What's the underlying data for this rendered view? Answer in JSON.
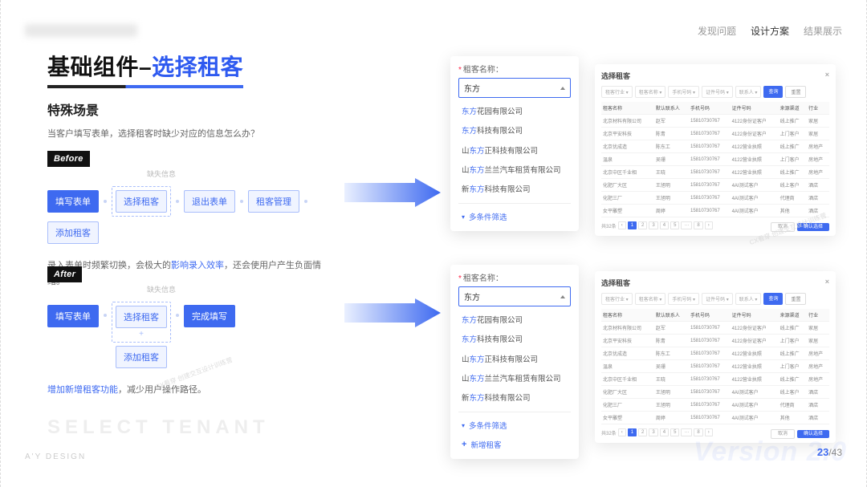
{
  "nav": {
    "item1": "发现问题",
    "item2": "设计方案",
    "item3": "结果展示"
  },
  "title": {
    "black": "基础组件–",
    "blue": "选择租客"
  },
  "section": {
    "subtitle": "特殊场景",
    "intro": "当客户填写表单，选择租客时缺少对应的信息怎么办？"
  },
  "before": {
    "badge": "Before",
    "hint": "缺失信息",
    "steps": [
      "填写表单",
      "选择租客",
      "退出表单",
      "租客管理",
      "添加租客"
    ],
    "desc_pre": "录入表单时频繁切换，会极大的",
    "desc_hl": "影响录入效率",
    "desc_suf": "，还会使用户产生负面情绪。"
  },
  "after": {
    "badge": "After",
    "hint": "缺失信息",
    "steps_row": [
      "填写表单",
      "选择租客",
      "完成填写"
    ],
    "add_label": "添加租客",
    "desc_pre": "",
    "desc_hl": "增加新增租客功能",
    "desc_suf": "，减少用户操作路径。"
  },
  "dropdown": {
    "label": "租客名称：",
    "required": "*",
    "input": "东方",
    "options": [
      {
        "prefix": "",
        "match": "东方",
        "suffix": "花园有限公司"
      },
      {
        "prefix": "",
        "match": "东方",
        "suffix": "科技有限公司"
      },
      {
        "prefix": "山",
        "match": "东方",
        "suffix": "正科技有限公司"
      },
      {
        "prefix": "山",
        "match": "东方",
        "suffix": "兰兰汽车租赁有限公司"
      },
      {
        "prefix": "新",
        "match": "东方",
        "suffix": "科技有限公司"
      }
    ],
    "filter_action": "多条件筛选",
    "add_action": "新增租客"
  },
  "table": {
    "title": "选择租客",
    "filters": [
      "租客行业",
      "租客名称",
      "手机号码",
      "证件号码",
      "联系人"
    ],
    "filter_more": "查询",
    "filter_reset": "重置",
    "headers": [
      "租客名称",
      "默认联系人",
      "手机号码",
      "证件号码",
      "来源渠道",
      "行业"
    ],
    "rows": [
      [
        "北京材料有限公司",
        "赵军",
        "15810730767",
        "4122身份证客户",
        "线上推广",
        "家居"
      ],
      [
        "北京平安科技",
        "陈青",
        "15810730767",
        "4122身份证客户",
        "上门客户",
        "家居"
      ],
      [
        "北京优成造",
        "陈东工",
        "15810730767",
        "4122营业执照",
        "线上推广",
        "房地产"
      ],
      [
        "温泉",
        "吴珊",
        "15810730767",
        "4122营业执照",
        "上门客户",
        "房地产"
      ],
      [
        "北京中区千业相",
        "王晓",
        "15810730767",
        "4122营业执照",
        "线上推广",
        "房地产"
      ],
      [
        "化肥厂大区",
        "王旭明",
        "15810730767",
        "4AI测试客户",
        "线上客户",
        "酒店"
      ],
      [
        "化肥三厂",
        "王旭明",
        "15810730767",
        "4AI测试客户",
        "代理商",
        "酒店"
      ],
      [
        "女平雕塑",
        "周婷",
        "15810730767",
        "4AI测试客户",
        "其他",
        "酒店"
      ]
    ],
    "pager_total": "共32条",
    "pager_pages": [
      "1",
      "2",
      "3",
      "4",
      "5",
      "···",
      "8"
    ],
    "cancel": "取消",
    "confirm": "确认选择"
  },
  "ghost": "SELECT  TENANT",
  "brand": "A'Y DESIGN",
  "version": "Version 2.0",
  "page": {
    "cur": "23",
    "total": "/43"
  },
  "watermark": "CX看穿 创建交互设计训练营"
}
